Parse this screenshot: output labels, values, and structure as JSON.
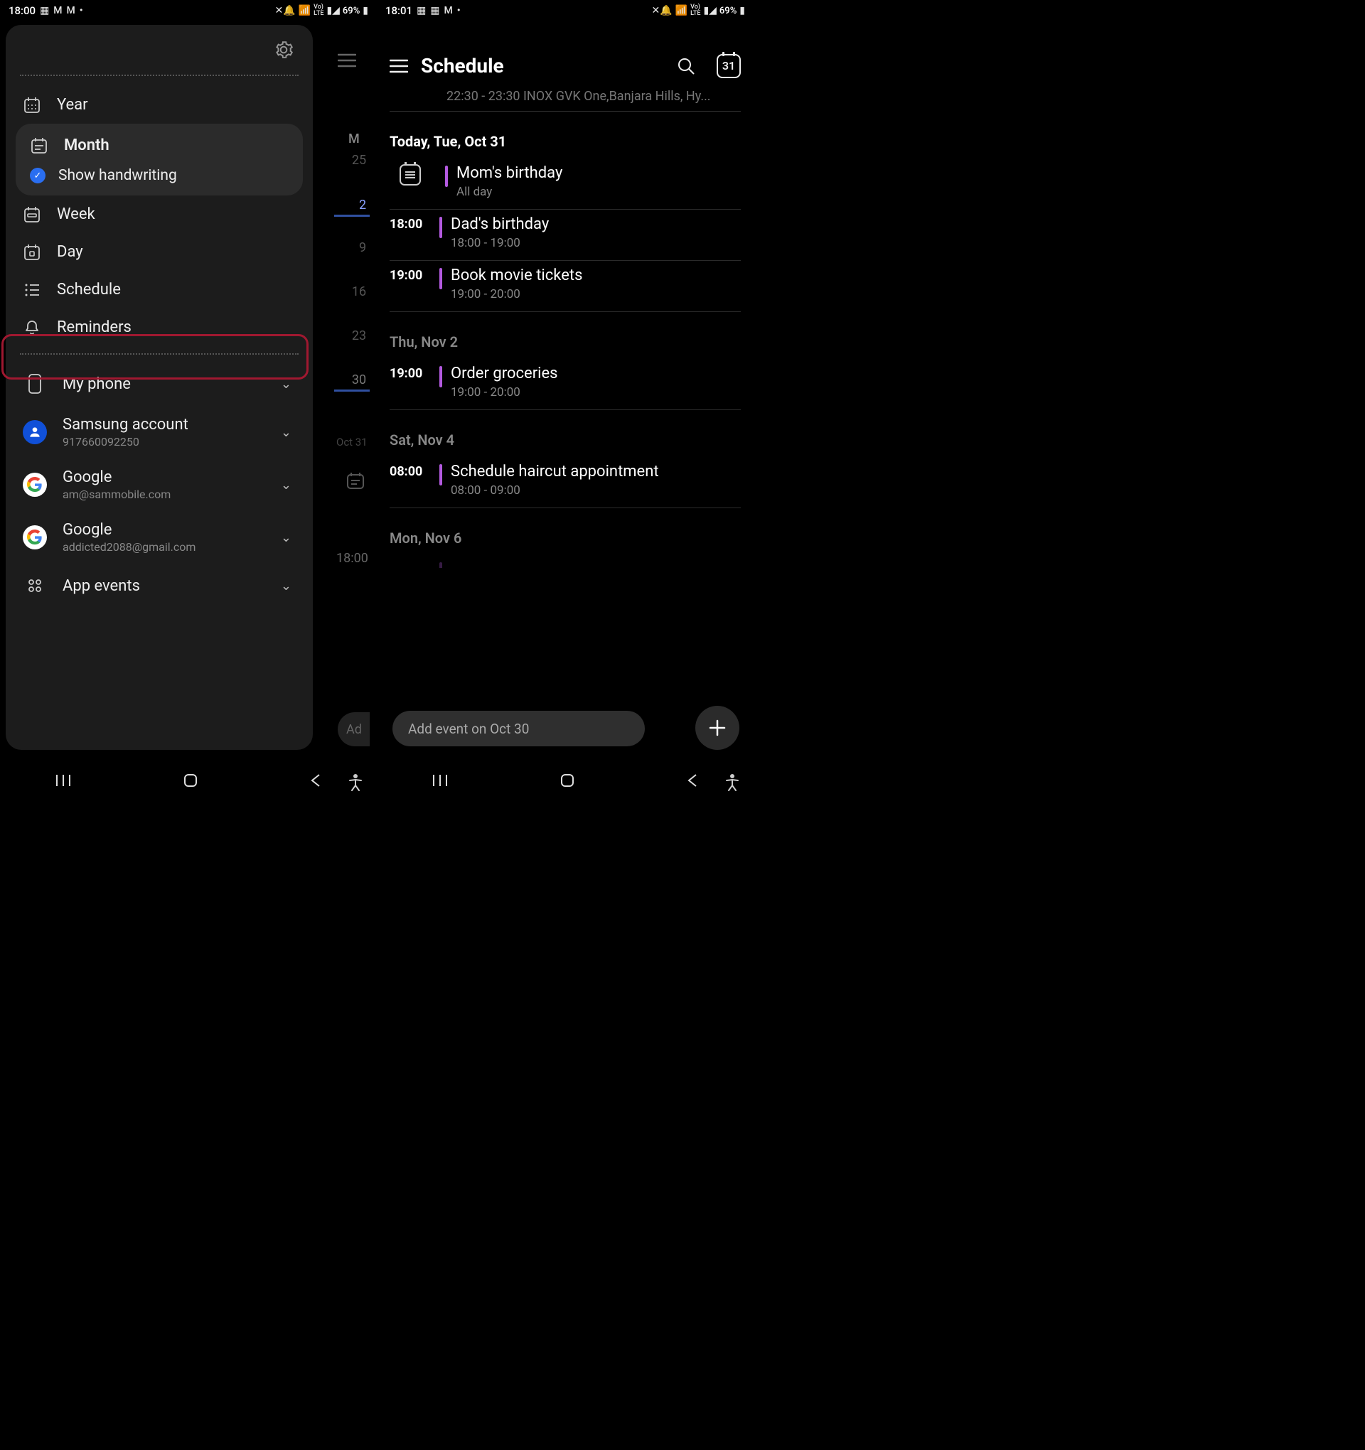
{
  "left": {
    "status": {
      "time": "18:00",
      "battery": "69%"
    },
    "drawer": {
      "views": {
        "year": "Year",
        "month": "Month",
        "handwriting": "Show handwriting",
        "week": "Week",
        "day": "Day",
        "schedule": "Schedule",
        "reminders": "Reminders"
      },
      "accounts": {
        "phone": "My phone",
        "samsung": {
          "title": "Samsung account",
          "sub": "917660092250"
        },
        "google1": {
          "title": "Google",
          "sub": "am@sammobile.com"
        },
        "google2": {
          "title": "Google",
          "sub": "addicted2088@gmail.com"
        },
        "appevents": "App events"
      }
    },
    "bg": {
      "day_letter": "M",
      "d25": "25",
      "d2": "2",
      "d9": "9",
      "d16": "16",
      "d23": "23",
      "d30": "30",
      "month_label": "Oct 31",
      "time_label": "18:00",
      "add_hint": "Ad"
    }
  },
  "right": {
    "status": {
      "time": "18:01",
      "battery": "69%"
    },
    "header": {
      "title": "Schedule",
      "today_num": "31"
    },
    "faded_prev": "22:30 - 23:30 INOX GVK One,Banjara Hills, Hy...",
    "dates": {
      "today": "Today, Tue, Oct 31",
      "nov2": "Thu, Nov 2",
      "nov4": "Sat, Nov 4",
      "nov6": "Mon, Nov 6"
    },
    "events": {
      "mom": {
        "title": "Mom's birthday",
        "sub": "All day"
      },
      "dad": {
        "time": "18:00",
        "title": "Dad's birthday",
        "sub": "18:00 - 19:00"
      },
      "movie": {
        "time": "19:00",
        "title": "Book movie tickets",
        "sub": "19:00 - 20:00"
      },
      "groceries": {
        "time": "19:00",
        "title": "Order groceries",
        "sub": "19:00 - 20:00"
      },
      "haircut": {
        "time": "08:00",
        "title": "Schedule haircut appointment",
        "sub": "08:00 - 09:00"
      }
    },
    "add_pill": "Add event on Oct 30"
  }
}
